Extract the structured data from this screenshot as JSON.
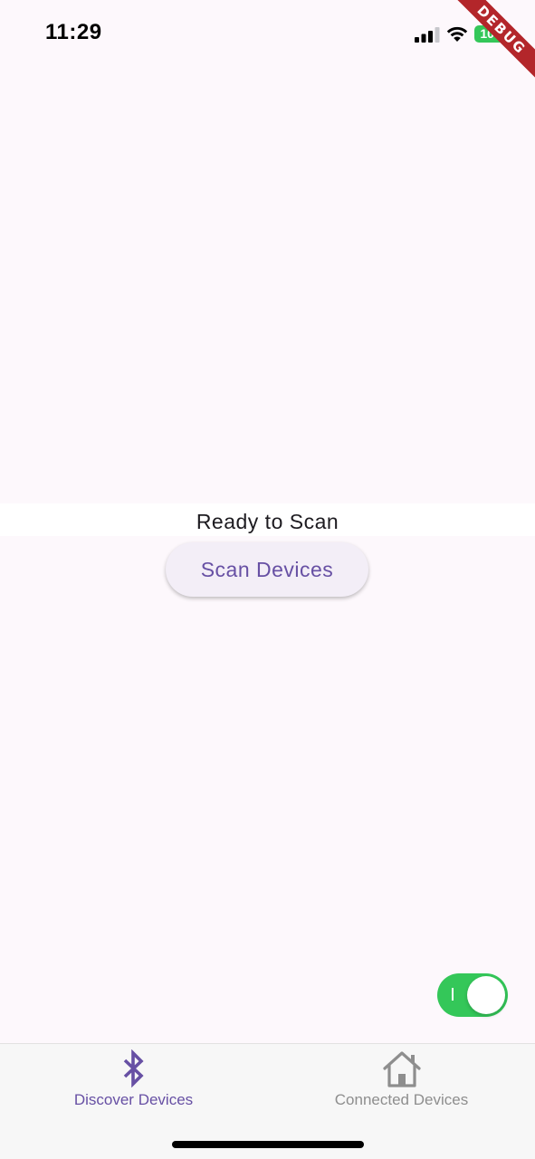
{
  "status_bar": {
    "time": "11:29",
    "battery": "100",
    "icons": [
      "cellular-signal-icon",
      "wifi-icon",
      "battery-icon"
    ]
  },
  "debug_banner": "DEBUG",
  "main": {
    "status_text": "Ready to Scan",
    "scan_button_label": "Scan Devices"
  },
  "toggle": {
    "state": "on",
    "color": "#34c759"
  },
  "bottom_nav": {
    "items": [
      {
        "label": "Discover Devices",
        "icon": "bluetooth-icon",
        "active": true
      },
      {
        "label": "Connected Devices",
        "icon": "home-icon",
        "active": false
      }
    ]
  },
  "colors": {
    "accent": "#6750a4",
    "background": "#fdf8fc",
    "inactive": "#8e8e8e",
    "debug": "#b3262a"
  }
}
